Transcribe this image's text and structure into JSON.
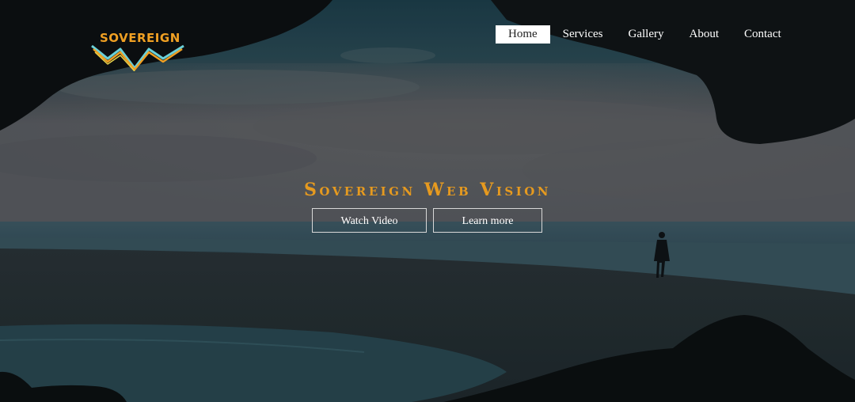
{
  "brand": {
    "name": "SOVEREIGN",
    "accent_color": "#f0a023"
  },
  "nav": {
    "items": [
      {
        "label": "Home",
        "active": true
      },
      {
        "label": "Services",
        "active": false
      },
      {
        "label": "Gallery",
        "active": false
      },
      {
        "label": "About",
        "active": false
      },
      {
        "label": "Contact",
        "active": false
      }
    ]
  },
  "hero": {
    "title": "Sovereign Web Vision",
    "title_color": "#e69a1f",
    "buttons": {
      "watch_video": "Watch Video",
      "learn_more": "Learn more"
    }
  }
}
